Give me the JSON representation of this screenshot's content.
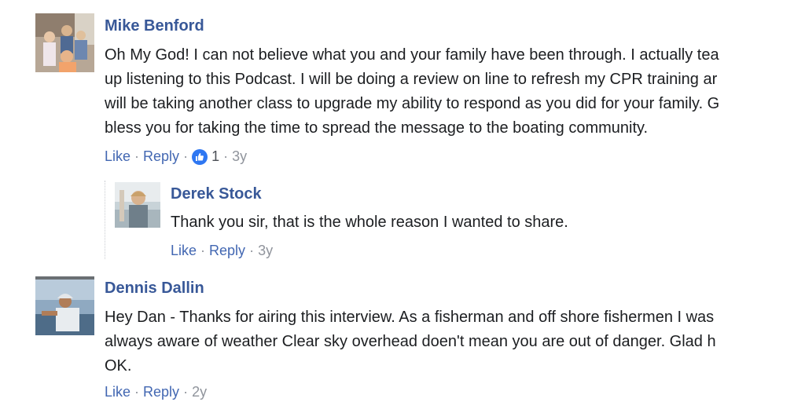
{
  "comments": [
    {
      "author": "Mike Benford",
      "lines": [
        "Oh My God! I can not believe what you and your family have been through. I actually tea",
        "up listening to this Podcast. I will be doing a review on line to refresh my CPR training ar",
        "will be taking another class to upgrade my ability to respond as you did for your family. G",
        "bless you for taking the time to spread the message to the boating community."
      ],
      "like_label": "Like",
      "reply_label": "Reply",
      "reaction_count": "1",
      "time": "3y",
      "reply": {
        "author": "Derek Stock",
        "lines": [
          "Thank you sir, that is the whole reason I wanted to share."
        ],
        "like_label": "Like",
        "reply_label": "Reply",
        "time": "3y"
      }
    },
    {
      "author": "Dennis Dallin",
      "lines": [
        "Hey Dan - Thanks for airing this interview. As a fisherman and off shore fishermen I was",
        "always aware of weather Clear sky overhead doen't mean you are out of danger. Glad h⁠",
        "OK."
      ],
      "like_label": "Like",
      "reply_label": "Reply",
      "time": "2y"
    }
  ],
  "colors": {
    "name": "#385898",
    "link": "#4267b2",
    "meta": "#90949c",
    "like_badge": "#2e77f2"
  },
  "icons": [
    "avatar-family-photo",
    "avatar-derek-photo",
    "avatar-dennis-photo",
    "like-icon"
  ]
}
